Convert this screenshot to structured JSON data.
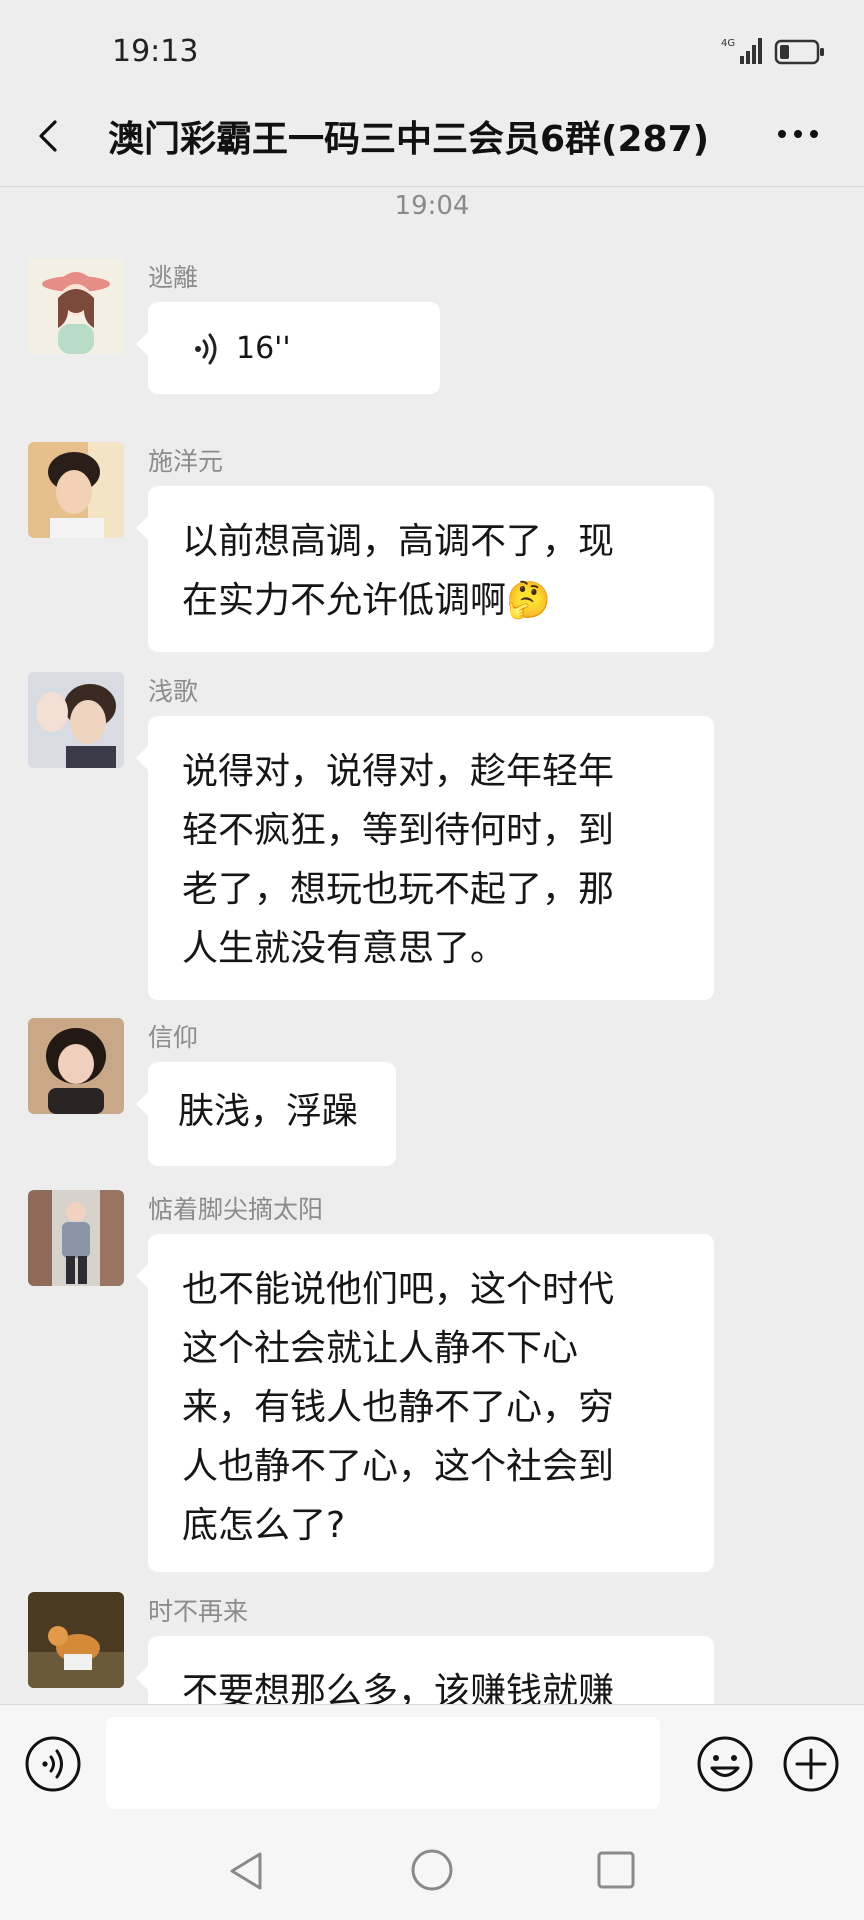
{
  "status_bar": {
    "time": "19:13",
    "network_label": "4G",
    "icons": [
      "signal-icon",
      "battery-icon"
    ]
  },
  "header": {
    "back_icon": "chevron-left-icon",
    "title": "澳门彩霸王一码三中三会员6群(287)",
    "more_icon": "more-dots-icon"
  },
  "chat": {
    "timestamp": "19:04",
    "messages": [
      {
        "sender": "逃離",
        "type": "voice",
        "duration": "16''"
      },
      {
        "sender": "施洋元",
        "type": "text",
        "lines": [
          "以前想高调，高调不了，现",
          "在实力不允许低调啊🤔"
        ]
      },
      {
        "sender": "浅歌",
        "type": "text",
        "lines": [
          "说得对，说得对，趁年轻年",
          "轻不疯狂，等到待何时，到",
          "老了，想玩也玩不起了，那",
          "人生就没有意思了。"
        ]
      },
      {
        "sender": "信仰",
        "type": "text",
        "lines": [
          "肤浅，浮躁"
        ]
      },
      {
        "sender": "惦着脚尖摘太阳",
        "type": "text",
        "lines": [
          "也不能说他们吧，这个时代",
          "这个社会就让人静不下心",
          "来，有钱人也静不了心，穷",
          "人也静不了心，这个社会到",
          "底怎么了?"
        ]
      },
      {
        "sender": "时不再来",
        "type": "text",
        "lines": [
          "不要想那么多，该赚钱就赚"
        ]
      }
    ]
  },
  "input_bar": {
    "value": "",
    "icons": [
      "voice-input-icon",
      "emoji-icon",
      "plus-icon"
    ]
  },
  "nav_bar": {
    "icons": [
      "nav-back-icon",
      "nav-home-icon",
      "nav-recent-icon"
    ]
  },
  "colors": {
    "background": "#ededed",
    "bubble": "#ffffff",
    "sender_text": "#8c8c8c",
    "title_text": "#111111"
  }
}
